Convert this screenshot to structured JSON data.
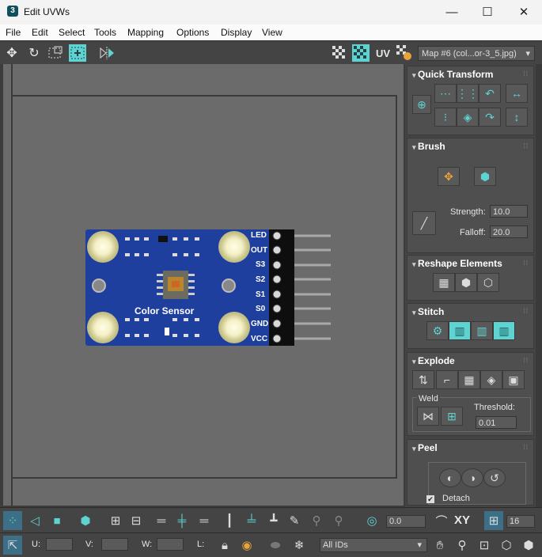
{
  "window": {
    "app_icon": "3",
    "title": "Edit UVWs",
    "minimize": "—",
    "maximize": "☐",
    "close": "✕"
  },
  "menu": [
    "File",
    "Edit",
    "Select",
    "Tools",
    "Mapping",
    "Options",
    "Display",
    "View"
  ],
  "toolbar": {
    "uv_label": "UV",
    "map_select": "Map #6 (col...or-3_5.jpg)",
    "dropdown_arrow": "▾"
  },
  "board": {
    "title": "Color Sensor",
    "pins": [
      "LED",
      "OUT",
      "S3",
      "S2",
      "S1",
      "S0",
      "GND",
      "VCC"
    ]
  },
  "panel": {
    "quick_transform": {
      "title": "Quick Transform"
    },
    "brush": {
      "title": "Brush",
      "strength_label": "Strength:",
      "strength_value": "10.0",
      "falloff_label": "Falloff:",
      "falloff_value": "20.0"
    },
    "reshape": {
      "title": "Reshape Elements"
    },
    "stitch": {
      "title": "Stitch"
    },
    "explode": {
      "title": "Explode",
      "weld_label": "Weld",
      "threshold_label": "Threshold:",
      "threshold_value": "0.01"
    },
    "peel": {
      "title": "Peel",
      "detach_label": "Detach",
      "detach_checked": true
    }
  },
  "bottom": {
    "angle_value": "0.0",
    "xy_label": "XY",
    "grid_value": "16",
    "u_label": "U:",
    "v_label": "V:",
    "w_label": "W:",
    "l_label": "L:",
    "ids_select": "All IDs"
  },
  "colors": {
    "accent": "#5fd2d2",
    "panel_bg": "#444444",
    "viewport_bg": "#6b6b6b",
    "board_blue": "#1f3f9e"
  }
}
